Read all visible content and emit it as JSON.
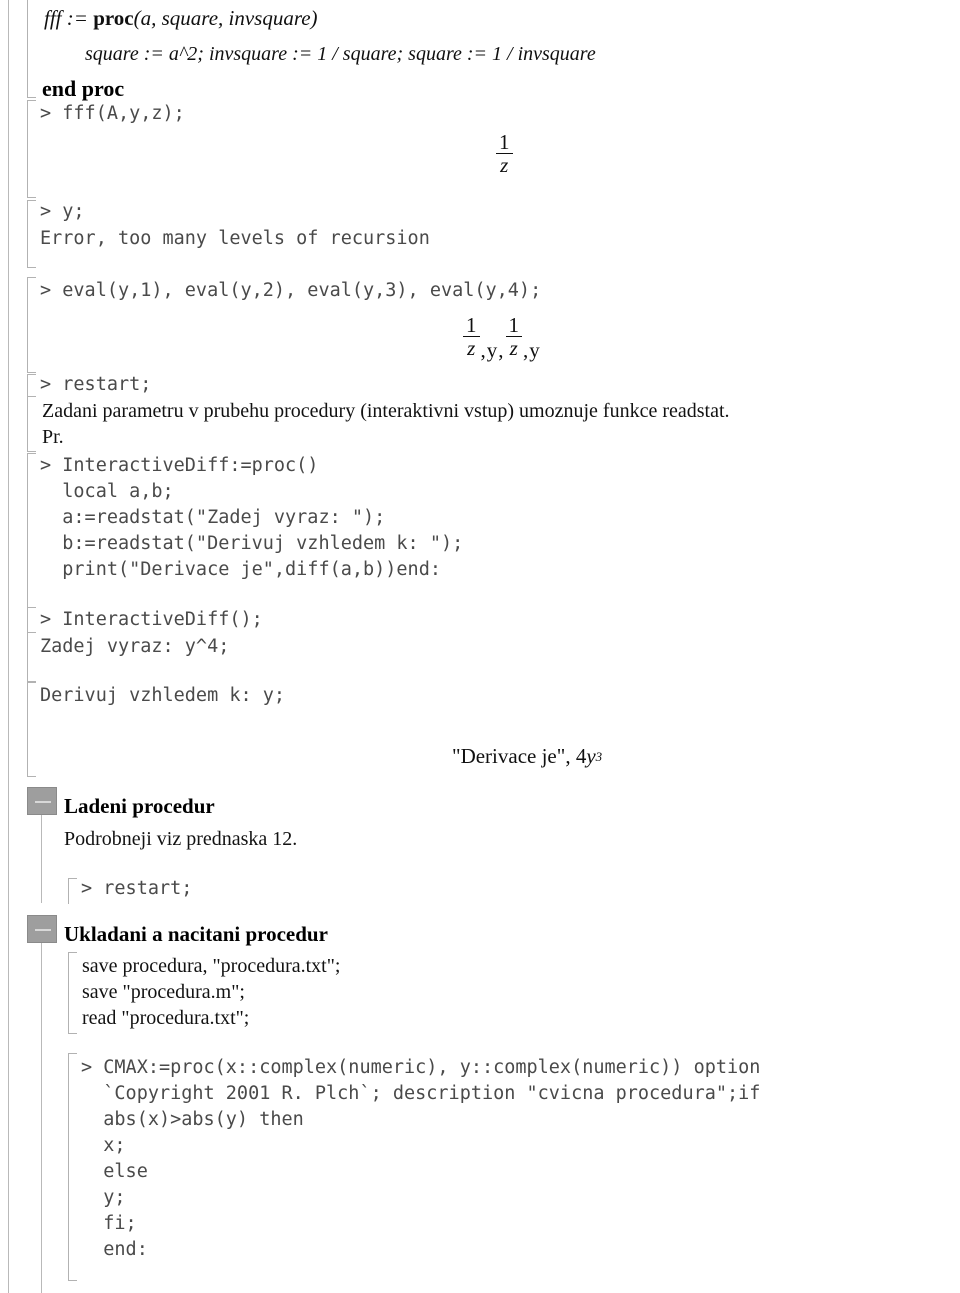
{
  "document": {
    "kind": "maple-worksheet",
    "colors": {
      "text": "#121212",
      "code_text": "#4a4a4a",
      "bracket": "#b2b2b2",
      "rail": "#b9b9b9",
      "collapse_box": "#9e9e9e"
    }
  },
  "blocks": {
    "proc_def_line1_head": "fff",
    "proc_def_line1_assign": " := ",
    "proc_def_line1_proc": "proc",
    "proc_def_line1_args": "(a, square, invsquare)",
    "proc_def_line2": "square := a^2; invsquare := 1 / square; square := 1 / invsquare",
    "proc_def_end": "end proc",
    "call_fff": "> fff(A,y,z);",
    "out_1_over_z_num": "1",
    "out_1_over_z_den": "z",
    "input_y": "> y;",
    "error_recursion": "Error, too many levels of recursion",
    "eval_line": "> eval(y,1), eval(y,2), eval(y,3), eval(y,4);",
    "eval_out": {
      "f1_num": "1",
      "f1_den": "z",
      "s1": ", ",
      "t1": "y",
      "s2": ", ",
      "f2_num": "1",
      "f2_den": "z",
      "s3": ", ",
      "t2": "y"
    },
    "restart_1": "> restart;",
    "note_readstat_line1": "Zadani parametru v prubehu procedury (interaktivni vstup) umoznuje funkce readstat.",
    "note_readstat_line2": "Pr.",
    "interactive_diff_def": [
      "> InteractiveDiff:=proc()",
      "  local a,b;",
      "  a:=readstat(\"Zadej vyraz: \");",
      "  b:=readstat(\"Derivuj vzhledem k: \");",
      "  print(\"Derivace je\",diff(a,b))end:"
    ],
    "interactive_diff_call": "> InteractiveDiff();",
    "prompt_zadej": "Zadej vyraz: y^4;",
    "prompt_derivuj": "Derivuj vzhledem k: y;",
    "derivace_out": {
      "quoted": "\"Derivace je\", 4 ",
      "base": "y",
      "exp": "3"
    },
    "section_ladeni_title": "Ladeni procedur",
    "section_ladeni_body": "Podrobneji viz prednaska 12.",
    "restart_2": "> restart;",
    "section_ukladani_title": "Ukladani a nacitani procedur",
    "section_ukladani_lines": [
      "save procedura, \"procedura.txt\";",
      "save \"procedura.m\";",
      "read \"procedura.txt\";"
    ],
    "cmax_def": [
      "> CMAX:=proc(x::complex(numeric), y::complex(numeric)) option",
      "  `Copyright 2001 R. Plch`; description \"cvicna procedura\";if",
      "  abs(x)>abs(y) then",
      "  x;",
      "  else",
      "  y;",
      "  fi;",
      "  end:"
    ]
  }
}
